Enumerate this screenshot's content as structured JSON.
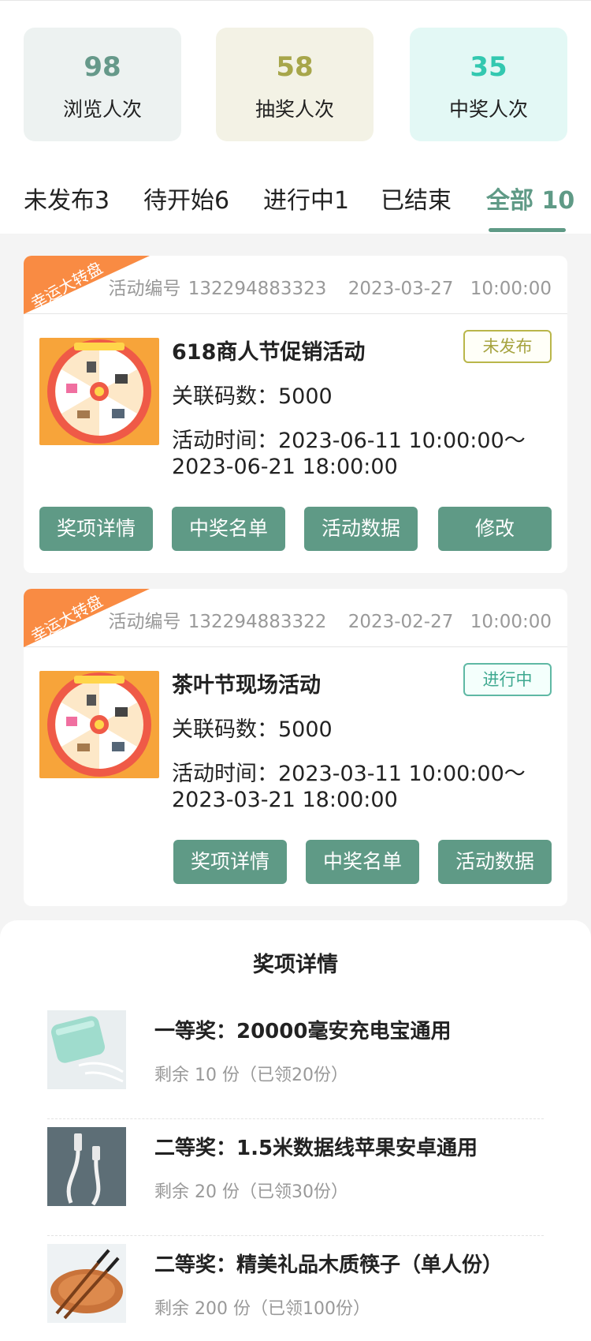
{
  "stats": [
    {
      "value": "98",
      "label": "浏览人次"
    },
    {
      "value": "58",
      "label": "抽奖人次"
    },
    {
      "value": "35",
      "label": "中奖人次"
    }
  ],
  "tabs": [
    {
      "label": "未发布3"
    },
    {
      "label": "待开始6"
    },
    {
      "label": "进行中1"
    },
    {
      "label": "已结束"
    },
    {
      "label": "全部 10",
      "active": true
    }
  ],
  "activities": [
    {
      "ribbon": "幸运大转盘",
      "code_label": "活动编号",
      "code": "132294883323",
      "created_date": "2023-03-27",
      "created_time": "10:00:00",
      "title": "618商人节促销活动",
      "status": "未发布",
      "codes_label": "关联码数：",
      "codes_count": "5000",
      "time_label": "活动时间：",
      "time_start": "2023-06-11 10:00:00～",
      "time_end": "2023-06-21 18:00:00",
      "buttons": [
        "奖项详情",
        "中奖名单",
        "活动数据",
        "修改"
      ]
    },
    {
      "ribbon": "幸运大转盘",
      "code_label": "活动编号",
      "code": "132294883322",
      "created_date": "2023-02-27",
      "created_time": "10:00:00",
      "title": "茶叶节现场活动",
      "status": "进行中",
      "codes_label": "关联码数：",
      "codes_count": "5000",
      "time_label": "活动时间：",
      "time_start": "2023-03-11 10:00:00～",
      "time_end": "2023-03-21 18:00:00",
      "buttons": [
        "奖项详情",
        "中奖名单",
        "活动数据"
      ]
    }
  ],
  "prize_sheet": {
    "title": "奖项详情",
    "prizes": [
      {
        "name": "一等奖：20000毫安充电宝通用",
        "stock": "剩余 10 份（已领20份）"
      },
      {
        "name": "二等奖：1.5米数据线苹果安卓通用",
        "stock": "剩余 20 份（已领30份）"
      },
      {
        "name": "二等奖：精美礼品木质筷子（单人份）",
        "stock": "剩余 200 份（已领100份）"
      }
    ]
  },
  "colors": {
    "primary": "#5f9a86",
    "ribbon": "#f98b43",
    "badge_unpublished": "#a6a33f",
    "badge_running": "#3da88f"
  }
}
